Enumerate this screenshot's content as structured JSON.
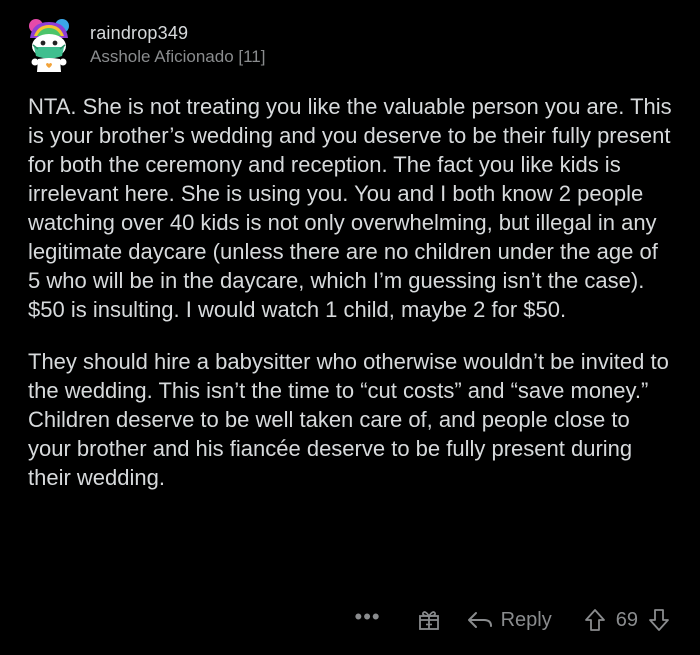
{
  "comment": {
    "author": "raindrop349",
    "flair": "Asshole Aficionado [11]",
    "paragraphs": [
      "NTA. She is not treating you like the valuable person you are. This is your brother’s wedding and you deserve to be their fully present for both the ceremony and reception. The fact you like kids is irrelevant here. She is using you. You and I both know 2 people watching over 40 kids is not only overwhelming, but illegal in any legitimate daycare (unless there are no children under the age of 5 who will be in the daycare, which I’m guessing isn’t the case). $50 is insulting. I would watch 1 child, maybe 2 for $50.",
      "They should hire a babysitter who otherwise wouldn’t be invited to the wedding. This isn’t the time to “cut costs” and “save money.” Children deserve to be well taken care of, and people close to your brother and his fiancée deserve to be fully present during their wedding."
    ]
  },
  "actions": {
    "more_label": "•••",
    "reply_label": "Reply",
    "score": "69"
  },
  "icons": {
    "more": "more-options-icon",
    "award": "gift-award-icon",
    "reply": "reply-arrow-icon",
    "upvote": "upvote-arrow-icon",
    "downvote": "downvote-arrow-icon"
  },
  "colors": {
    "background": "#000000",
    "text": "#d7dadc",
    "muted": "#8a8c8e"
  }
}
